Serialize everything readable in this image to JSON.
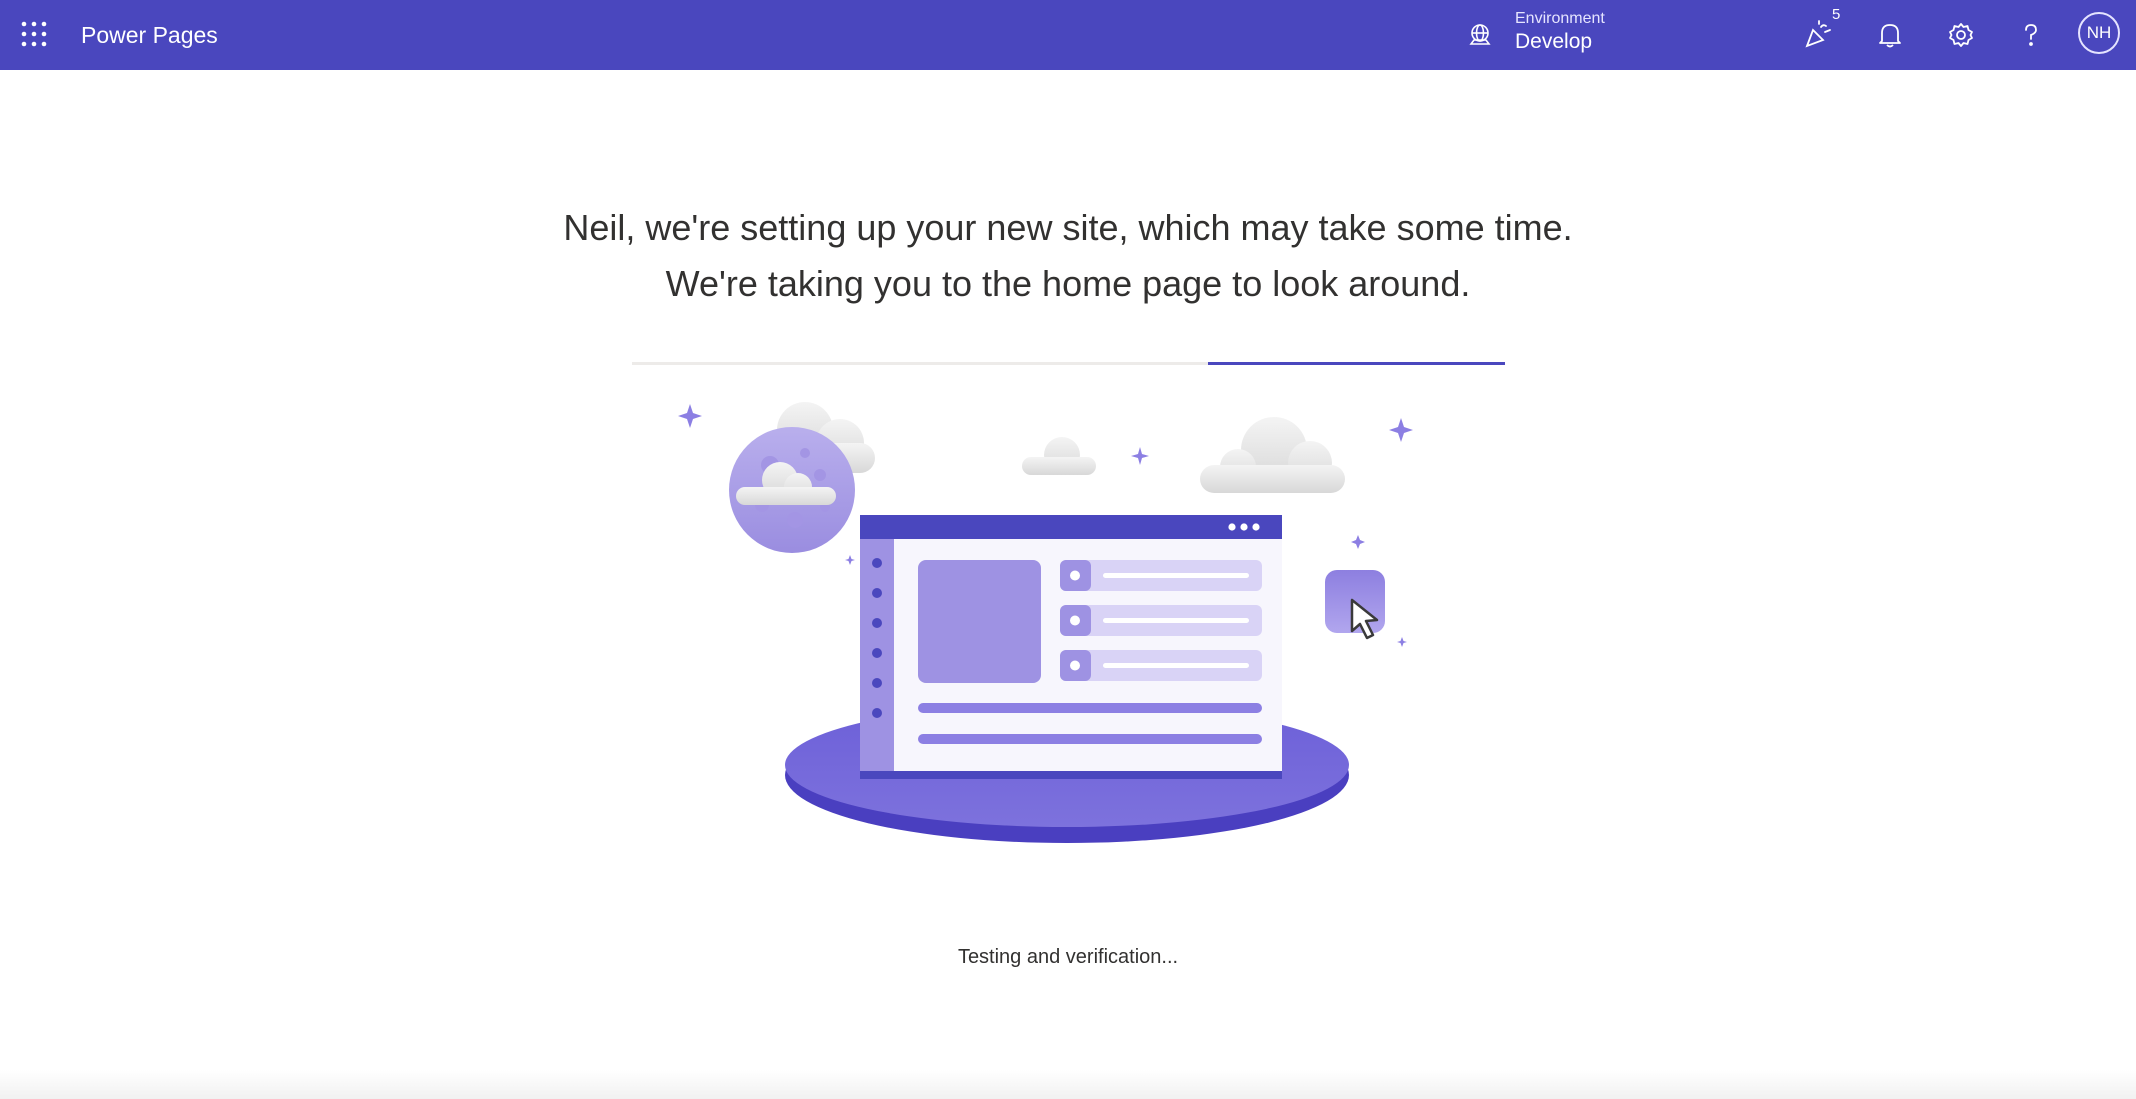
{
  "header": {
    "app_title": "Power Pages",
    "environment_label": "Environment",
    "environment_name": "Develop",
    "celebration_count": "5",
    "avatar_initials": "NH",
    "icons": [
      "waffle-icon",
      "environment-icon",
      "celebration-icon",
      "bell-icon",
      "gear-icon",
      "help-icon"
    ]
  },
  "main": {
    "headline_line1": "Neil, we're setting up your new site, which may take some time.",
    "headline_line2": "We're taking you to the home page to look around.",
    "progress_indicator": {
      "start": 0.66,
      "end": 1.0
    },
    "status_text": "Testing and verification..."
  },
  "colors": {
    "brand": "#4a47be",
    "accent_light": "#9b8fe0",
    "text": "#323130"
  }
}
